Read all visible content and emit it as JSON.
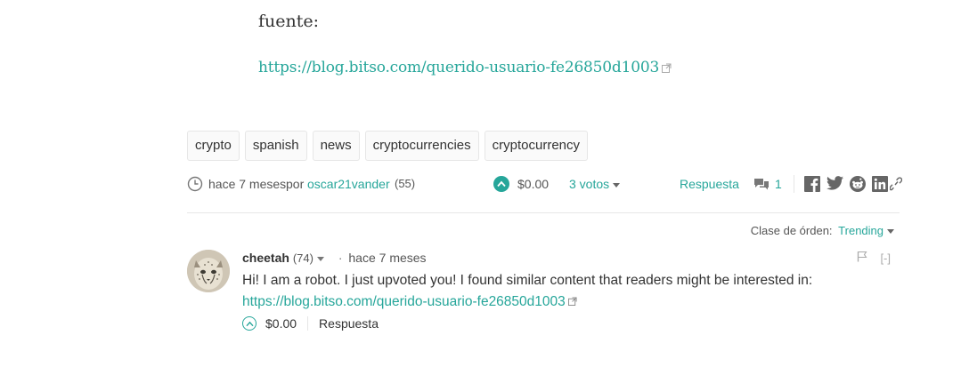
{
  "post": {
    "intro": "fuente:",
    "source_link": "https://blog.bitso.com/querido-usuario-fe26850d1003"
  },
  "tags": [
    "crypto",
    "spanish",
    "news",
    "cryptocurrencies",
    "cryptocurrency"
  ],
  "meta": {
    "time": "hace 7 meses",
    "by": "por",
    "author": "oscar21vander",
    "reputation": "(55)",
    "payout": "$0.00",
    "votes": "3 votos",
    "reply": "Respuesta",
    "comment_count": "1"
  },
  "sort": {
    "label": "Clase de órden:",
    "value": "Trending"
  },
  "comment": {
    "author": "cheetah",
    "reputation": "(74)",
    "time": "hace 7 meses",
    "collapse": "[-]",
    "body_text": "Hi! I am a robot. I just upvoted you! I found similar content that readers might be interested in:",
    "body_link": "https://blog.bitso.com/querido-usuario-fe26850d1003",
    "payout": "$0.00",
    "reply": "Respuesta"
  },
  "colors": {
    "accent": "#26a69a",
    "text": "#333333",
    "muted": "#555555",
    "border": "#e6e6e6"
  },
  "icons": [
    "external-link-icon",
    "clock-icon",
    "upvote-icon",
    "comments-icon",
    "facebook-icon",
    "twitter-icon",
    "reddit-icon",
    "linkedin-icon",
    "link-icon",
    "flag-icon",
    "caret-down-icon"
  ]
}
